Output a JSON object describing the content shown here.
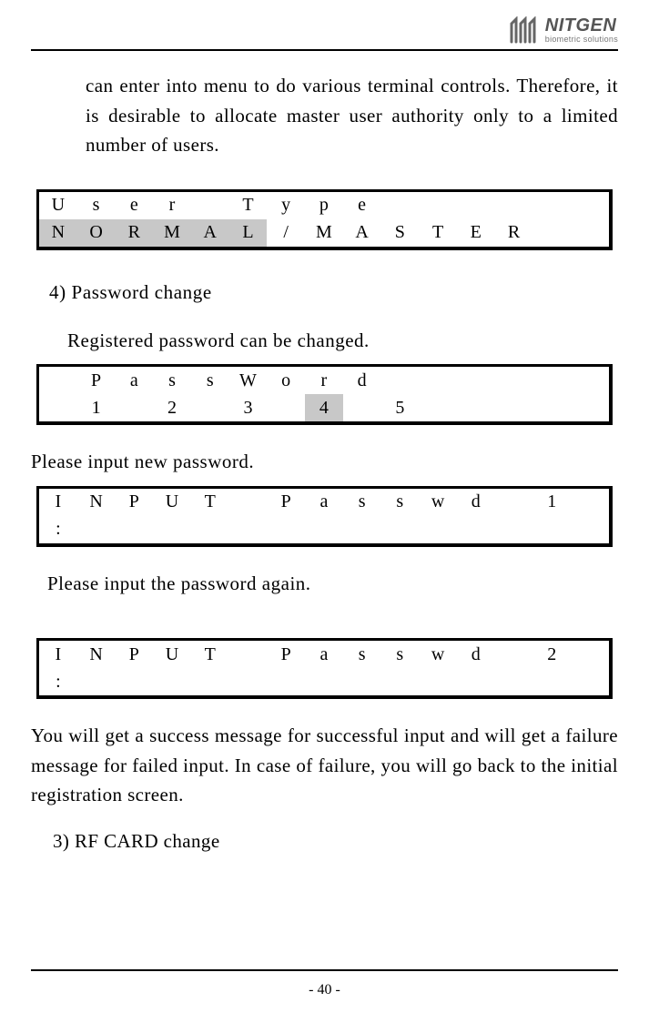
{
  "logo": {
    "brand": "NITGEN",
    "sub": "biometric solutions"
  },
  "para1": "can enter into menu to do various terminal controls. Therefore, it is desirable to allocate master user authority only to a limited number of users.",
  "lcd1": {
    "r1": [
      "U",
      "s",
      "e",
      "r",
      "",
      "T",
      "y",
      "p",
      "e",
      "",
      "",
      "",
      "",
      "",
      ""
    ],
    "r2": [
      "N",
      "O",
      "R",
      "M",
      "A",
      "L",
      "/",
      "M",
      "A",
      "S",
      "T",
      "E",
      "R",
      "",
      ""
    ]
  },
  "heading4": "4)  Password change",
  "line_reg": "Registered password can be changed.",
  "lcd2": {
    "r1": [
      "",
      "P",
      "a",
      "s",
      "s",
      "W",
      "o",
      "r",
      "d",
      "",
      "",
      "",
      "",
      "",
      ""
    ],
    "r2": [
      "",
      "1",
      "",
      "2",
      "",
      "3",
      "",
      "4",
      "",
      "5",
      "",
      "",
      "",
      "",
      ""
    ]
  },
  "line_new": "Please input new password.",
  "lcd3": {
    "r1": [
      "I",
      "N",
      "P",
      "U",
      "T",
      "",
      "P",
      "a",
      "s",
      "s",
      "w",
      "d",
      "",
      "1",
      ""
    ],
    "r2": [
      ":",
      "",
      "",
      "",
      "",
      "",
      "",
      "",
      "",
      "",
      "",
      "",
      "",
      "",
      ""
    ]
  },
  "line_again": "Please input the password again.",
  "lcd4": {
    "r1": [
      "I",
      "N",
      "P",
      "U",
      "T",
      "",
      "P",
      "a",
      "s",
      "s",
      "w",
      "d",
      "",
      "2",
      ""
    ],
    "r2": [
      ":",
      "",
      "",
      "",
      "",
      "",
      "",
      "",
      "",
      "",
      "",
      "",
      "",
      "",
      ""
    ]
  },
  "para2": "You will get a success message for successful input and will get a failure message for failed input. In case of failure, you will go back to the initial registration screen.",
  "heading3": "3)  RF CARD change",
  "footer": "- 40 -"
}
